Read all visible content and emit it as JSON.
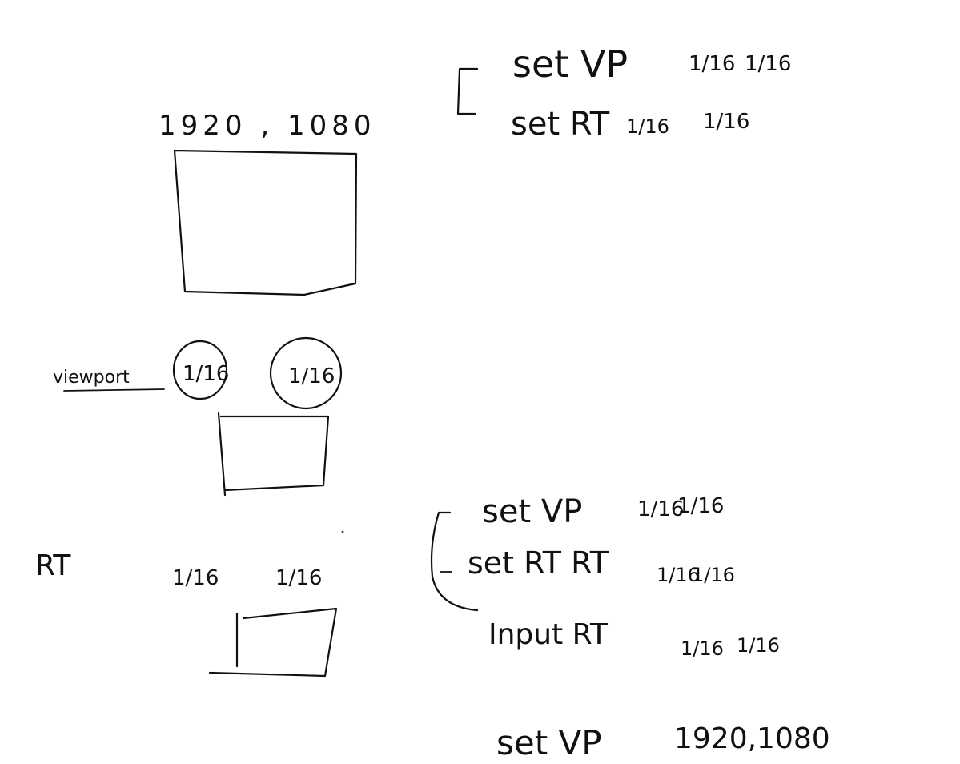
{
  "diagram": {
    "ink_color": "#111111",
    "background": "#ffffff",
    "left": {
      "resolution_label": "1920 , 1080",
      "viewport_label": "viewport",
      "viewport_scale_x": "1/16",
      "viewport_scale_y": "1/16",
      "rt_label": "RT",
      "rt_scale_x": "1/16",
      "rt_scale_y": "1/16"
    },
    "right_top": {
      "line1": {
        "cmd": "set VP",
        "a": "1/16",
        "b": "1/16"
      },
      "line2": {
        "cmd": "set RT",
        "a": "1/16",
        "b": "1/16"
      }
    },
    "right_bottom": {
      "line1": {
        "cmd": "set VP",
        "a": "1/16",
        "b": "1/16"
      },
      "line2": {
        "cmd": "set RT RT",
        "a": "1/16",
        "b": "1/16"
      },
      "line3": {
        "cmd": "Input RT",
        "a": "1/16",
        "b": "1/16"
      },
      "line4": {
        "cmd": "set VP",
        "a": "1920,1080"
      }
    }
  }
}
